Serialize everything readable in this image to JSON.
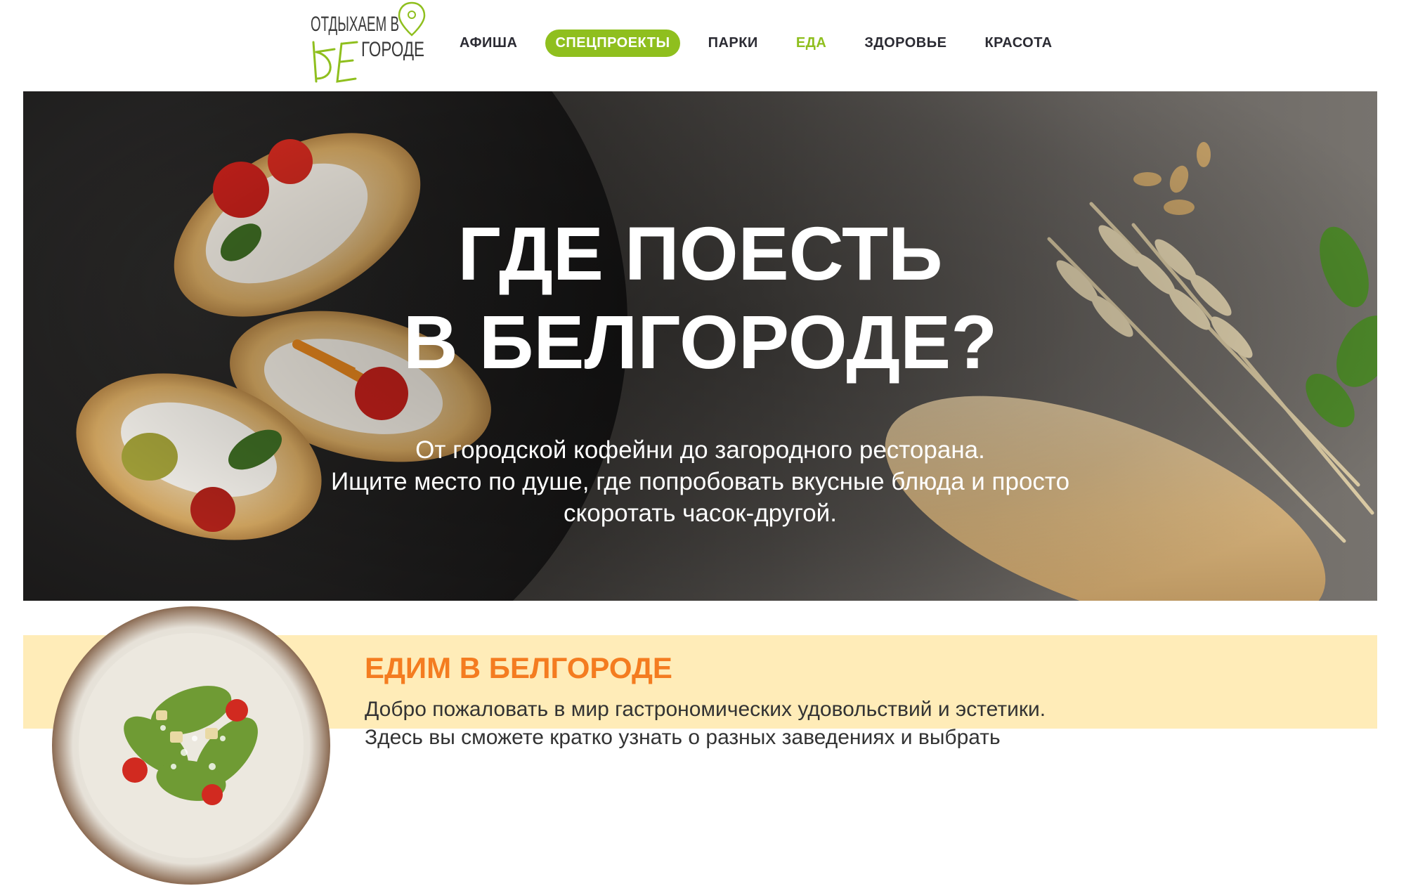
{
  "brand": {
    "logo_lines": [
      "ОТДЫХАЕМ В",
      "БЕЛГОРОДЕ"
    ],
    "accent_color": "#8fbf1e"
  },
  "nav": {
    "items": [
      {
        "label": "АФИША"
      },
      {
        "label": "СПЕЦПРОЕКТЫ"
      },
      {
        "label": "ПАРКИ"
      },
      {
        "label": "ЕДА"
      },
      {
        "label": "ЗДОРОВЬЕ"
      },
      {
        "label": "КРАСОТА"
      }
    ],
    "highlighted": "СПЕЦПРОЕКТЫ",
    "current": "ЕДА"
  },
  "hero": {
    "title_lines": [
      "ГДЕ ПОЕСТЬ",
      "В БЕЛГОРОДЕ?"
    ],
    "subtitle_lines": [
      "От городской кофейни до загородного ресторана.",
      "Ищите место по душе, где попробовать вкусные блюда и просто",
      "скоротать часок-другой."
    ],
    "image_icon": "bruschetta-bread-wheat-photo"
  },
  "intro": {
    "title": "ЕДИМ В БЕЛГОРОДЕ",
    "text_lines": [
      "Добро пожаловать в мир гастрономических удовольствий и эстетики.",
      "Здесь вы сможете кратко узнать о разных заведениях и выбрать"
    ],
    "image_icon": "salad-plate-photo",
    "title_color": "#f47c20",
    "background_color": "#ffecb8"
  }
}
